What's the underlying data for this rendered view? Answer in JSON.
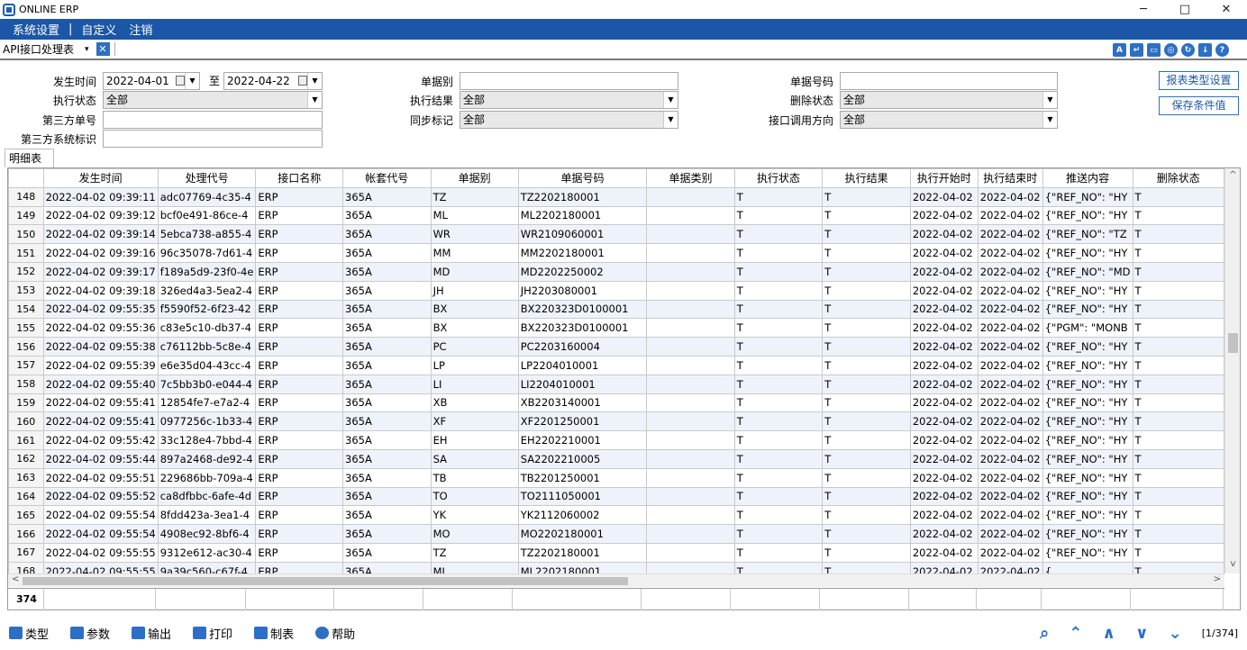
{
  "window": {
    "title": "ONLINE ERP",
    "min": "─",
    "max": "□",
    "close": "✕"
  },
  "menu": {
    "items": [
      "系统设置",
      "|",
      "自定义",
      "注销"
    ]
  },
  "tab": {
    "title": "API接口处理表",
    "dropdown": "▾",
    "close": "✕"
  },
  "toolbar_icons": [
    "report-icon",
    "export-icon",
    "calendar-icon",
    "globe-icon",
    "refresh-icon",
    "import-icon",
    "help-icon"
  ],
  "filters": {
    "occur_time_label": "发生时间",
    "date_from": "2022-04-01",
    "to_label": "至",
    "date_to": "2022-04-22",
    "exec_status_label": "执行状态",
    "exec_status_value": "全部",
    "third_order_label": "第三方单号",
    "third_order_value": "",
    "third_system_label": "第三方系统标识",
    "third_system_value": "",
    "doc_type_label": "单据别",
    "doc_type_value": "",
    "exec_result_label": "执行结果",
    "exec_result_value": "全部",
    "sync_flag_label": "同步标记",
    "sync_flag_value": "全部",
    "doc_no_label": "单据号码",
    "doc_no_value": "",
    "delete_status_label": "删除状态",
    "delete_status_value": "全部",
    "direction_label": "接口调用方向",
    "direction_value": "全部"
  },
  "buttons": {
    "report_type": "报表类型设置",
    "save_condition": "保存条件值"
  },
  "detail_tab": "明细表",
  "grid": {
    "columns": [
      "",
      "发生时间",
      "处理代号",
      "接口名称",
      "帐套代号",
      "单据别",
      "单据号码",
      "单据类别",
      "执行状态",
      "执行结果",
      "执行开始时",
      "执行结束时",
      "推送内容",
      "删除状态"
    ],
    "rows": [
      [
        "148",
        "2022-04-02 09:39:11",
        "adc07769-4c35-4",
        "ERP",
        "365A",
        "TZ",
        "TZ2202180001",
        "",
        "T",
        "T",
        "2022-04-02",
        "2022-04-02",
        "{\"REF_NO\": \"HY",
        "T"
      ],
      [
        "149",
        "2022-04-02 09:39:12",
        "bcf0e491-86ce-4",
        "ERP",
        "365A",
        "ML",
        "ML2202180001",
        "",
        "T",
        "T",
        "2022-04-02",
        "2022-04-02",
        "{\"REF_NO\": \"HY",
        "T"
      ],
      [
        "150",
        "2022-04-02 09:39:14",
        "5ebca738-a855-4",
        "ERP",
        "365A",
        "WR",
        "WR2109060001",
        "",
        "T",
        "T",
        "2022-04-02",
        "2022-04-02",
        "{\"REF_NO\": \"TZ",
        "T"
      ],
      [
        "151",
        "2022-04-02 09:39:16",
        "96c35078-7d61-4",
        "ERP",
        "365A",
        "MM",
        "MM2202180001",
        "",
        "T",
        "T",
        "2022-04-02",
        "2022-04-02",
        "{\"REF_NO\": \"HY",
        "T"
      ],
      [
        "152",
        "2022-04-02 09:39:17",
        "f189a5d9-23f0-4e",
        "ERP",
        "365A",
        "MD",
        "MD2202250002",
        "",
        "T",
        "T",
        "2022-04-02",
        "2022-04-02",
        "{\"REF_NO\": \"MD",
        "T"
      ],
      [
        "153",
        "2022-04-02 09:39:18",
        "326ed4a3-5ea2-4",
        "ERP",
        "365A",
        "JH",
        "JH2203080001",
        "",
        "T",
        "T",
        "2022-04-02",
        "2022-04-02",
        "{\"REF_NO\": \"HY",
        "T"
      ],
      [
        "154",
        "2022-04-02 09:55:35",
        "f5590f52-6f23-42",
        "ERP",
        "365A",
        "BX",
        "BX220323D0100001",
        "",
        "T",
        "T",
        "2022-04-02",
        "2022-04-02",
        "{\"REF_NO\": \"HY",
        "T"
      ],
      [
        "155",
        "2022-04-02 09:55:36",
        "c83e5c10-db37-4",
        "ERP",
        "365A",
        "BX",
        "BX220323D0100001",
        "",
        "T",
        "T",
        "2022-04-02",
        "2022-04-02",
        "{\"PGM\": \"MONB",
        "T"
      ],
      [
        "156",
        "2022-04-02 09:55:38",
        "c76112bb-5c8e-4",
        "ERP",
        "365A",
        "PC",
        "PC2203160004",
        "",
        "T",
        "T",
        "2022-04-02",
        "2022-04-02",
        "{\"REF_NO\": \"HY",
        "T"
      ],
      [
        "157",
        "2022-04-02 09:55:39",
        "e6e35d04-43cc-4",
        "ERP",
        "365A",
        "LP",
        "LP2204010001",
        "",
        "T",
        "T",
        "2022-04-02",
        "2022-04-02",
        "{\"REF_NO\": \"HY",
        "T"
      ],
      [
        "158",
        "2022-04-02 09:55:40",
        "7c5bb3b0-e044-4",
        "ERP",
        "365A",
        "LI",
        "LI2204010001",
        "",
        "T",
        "T",
        "2022-04-02",
        "2022-04-02",
        "{\"REF_NO\": \"HY",
        "T"
      ],
      [
        "159",
        "2022-04-02 09:55:41",
        "12854fe7-e7a2-4",
        "ERP",
        "365A",
        "XB",
        "XB2203140001",
        "",
        "T",
        "T",
        "2022-04-02",
        "2022-04-02",
        "{\"REF_NO\": \"HY",
        "T"
      ],
      [
        "160",
        "2022-04-02 09:55:41",
        "0977256c-1b33-4",
        "ERP",
        "365A",
        "XF",
        "XF2201250001",
        "",
        "T",
        "T",
        "2022-04-02",
        "2022-04-02",
        "{\"REF_NO\": \"HY",
        "T"
      ],
      [
        "161",
        "2022-04-02 09:55:42",
        "33c128e4-7bbd-4",
        "ERP",
        "365A",
        "EH",
        "EH2202210001",
        "",
        "T",
        "T",
        "2022-04-02",
        "2022-04-02",
        "{\"REF_NO\": \"HY",
        "T"
      ],
      [
        "162",
        "2022-04-02 09:55:44",
        "897a2468-de92-4",
        "ERP",
        "365A",
        "SA",
        "SA2202210005",
        "",
        "T",
        "T",
        "2022-04-02",
        "2022-04-02",
        "{\"REF_NO\": \"HY",
        "T"
      ],
      [
        "163",
        "2022-04-02 09:55:51",
        "229686bb-709a-4",
        "ERP",
        "365A",
        "TB",
        "TB2201250001",
        "",
        "T",
        "T",
        "2022-04-02",
        "2022-04-02",
        "{\"REF_NO\": \"HY",
        "T"
      ],
      [
        "164",
        "2022-04-02 09:55:52",
        "ca8dfbbc-6afe-4d",
        "ERP",
        "365A",
        "TO",
        "TO2111050001",
        "",
        "T",
        "T",
        "2022-04-02",
        "2022-04-02",
        "{\"REF_NO\": \"HY",
        "T"
      ],
      [
        "165",
        "2022-04-02 09:55:54",
        "8fdd423a-3ea1-4",
        "ERP",
        "365A",
        "YK",
        "YK2112060002",
        "",
        "T",
        "T",
        "2022-04-02",
        "2022-04-02",
        "{\"REF_NO\": \"HY",
        "T"
      ],
      [
        "166",
        "2022-04-02 09:55:54",
        "4908ec92-8bf6-4",
        "ERP",
        "365A",
        "MO",
        "MO2202180001",
        "",
        "T",
        "T",
        "2022-04-02",
        "2022-04-02",
        "{\"REF_NO\": \"HY",
        "T"
      ],
      [
        "167",
        "2022-04-02 09:55:55",
        "9312e612-ac30-4",
        "ERP",
        "365A",
        "TZ",
        "TZ2202180001",
        "",
        "T",
        "T",
        "2022-04-02",
        "2022-04-02",
        "{\"REF_NO\": \"HY",
        "T"
      ],
      [
        "168",
        "2022-04-02 09:55:55",
        "9a39c560-c67f-4",
        "ERP",
        "365A",
        "ML",
        "ML2202180001",
        "",
        "T",
        "T",
        "2022-04-02",
        "2022-04-02",
        "{",
        "T"
      ]
    ],
    "footer_count": "374"
  },
  "bottom": {
    "type": "类型",
    "params": "参数",
    "export": "输出",
    "print": "打印",
    "make_table": "制表",
    "help": "帮助",
    "page": "[1/374]"
  },
  "colors": {
    "menu_bg": "#1c56a6",
    "accent": "#2d6fc4",
    "row_alt": "#eef3fb"
  }
}
